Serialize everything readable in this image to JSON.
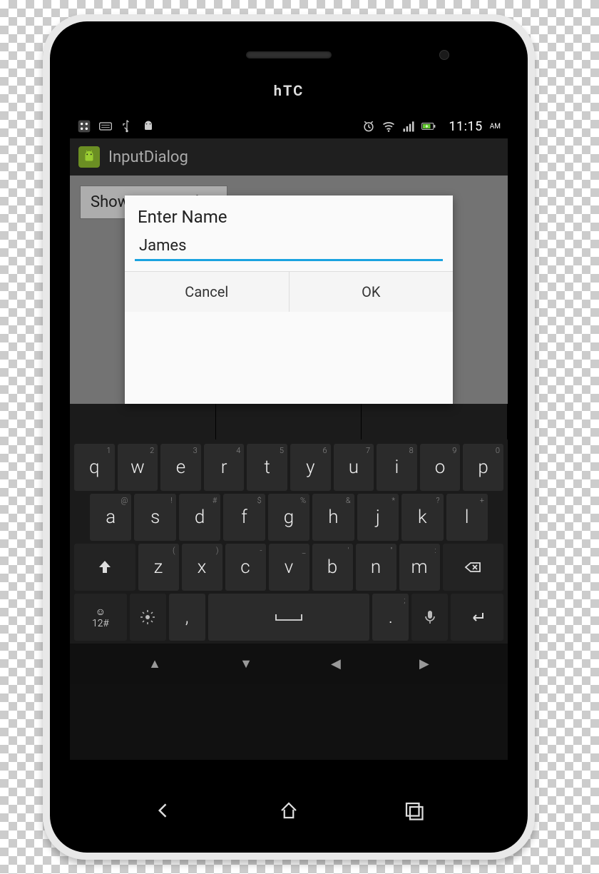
{
  "device": {
    "brand": "hTC"
  },
  "statusbar": {
    "left_icons": [
      "bbm-icon",
      "keyboard-icon",
      "usb-icon",
      "android-debug-icon"
    ],
    "right_icons": [
      "alarm-icon",
      "wifi-icon",
      "signal-icon",
      "battery-charging-icon"
    ],
    "time": "11:15",
    "ampm": "AM"
  },
  "appbar": {
    "title": "InputDialog"
  },
  "page": {
    "show_button_label": "Show Input Dialog"
  },
  "dialog": {
    "title": "Enter Name",
    "input_value": "James",
    "cancel_label": "Cancel",
    "ok_label": "OK"
  },
  "keyboard": {
    "row1": [
      {
        "k": "q",
        "h": "1"
      },
      {
        "k": "w",
        "h": "2"
      },
      {
        "k": "e",
        "h": "3"
      },
      {
        "k": "r",
        "h": "4"
      },
      {
        "k": "t",
        "h": "5"
      },
      {
        "k": "y",
        "h": "6"
      },
      {
        "k": "u",
        "h": "7"
      },
      {
        "k": "i",
        "h": "8"
      },
      {
        "k": "o",
        "h": "9"
      },
      {
        "k": "p",
        "h": "0"
      }
    ],
    "row2": [
      {
        "k": "a",
        "h": "@"
      },
      {
        "k": "s",
        "h": "!"
      },
      {
        "k": "d",
        "h": "#"
      },
      {
        "k": "f",
        "h": "$"
      },
      {
        "k": "g",
        "h": "%"
      },
      {
        "k": "h",
        "h": "&"
      },
      {
        "k": "j",
        "h": "*"
      },
      {
        "k": "k",
        "h": "?"
      },
      {
        "k": "l",
        "h": "+"
      }
    ],
    "row3": [
      {
        "k": "z",
        "h": "("
      },
      {
        "k": "x",
        "h": ")"
      },
      {
        "k": "c",
        "h": "-"
      },
      {
        "k": "v",
        "h": "_"
      },
      {
        "k": "b",
        "h": "'"
      },
      {
        "k": "n",
        "h": "\""
      },
      {
        "k": "m",
        "h": ":"
      }
    ],
    "modeKey": "12#",
    "commaKey": ",",
    "periodKey": ".",
    "periodHint": ";"
  },
  "softkeys": [
    "back",
    "home",
    "recent"
  ]
}
